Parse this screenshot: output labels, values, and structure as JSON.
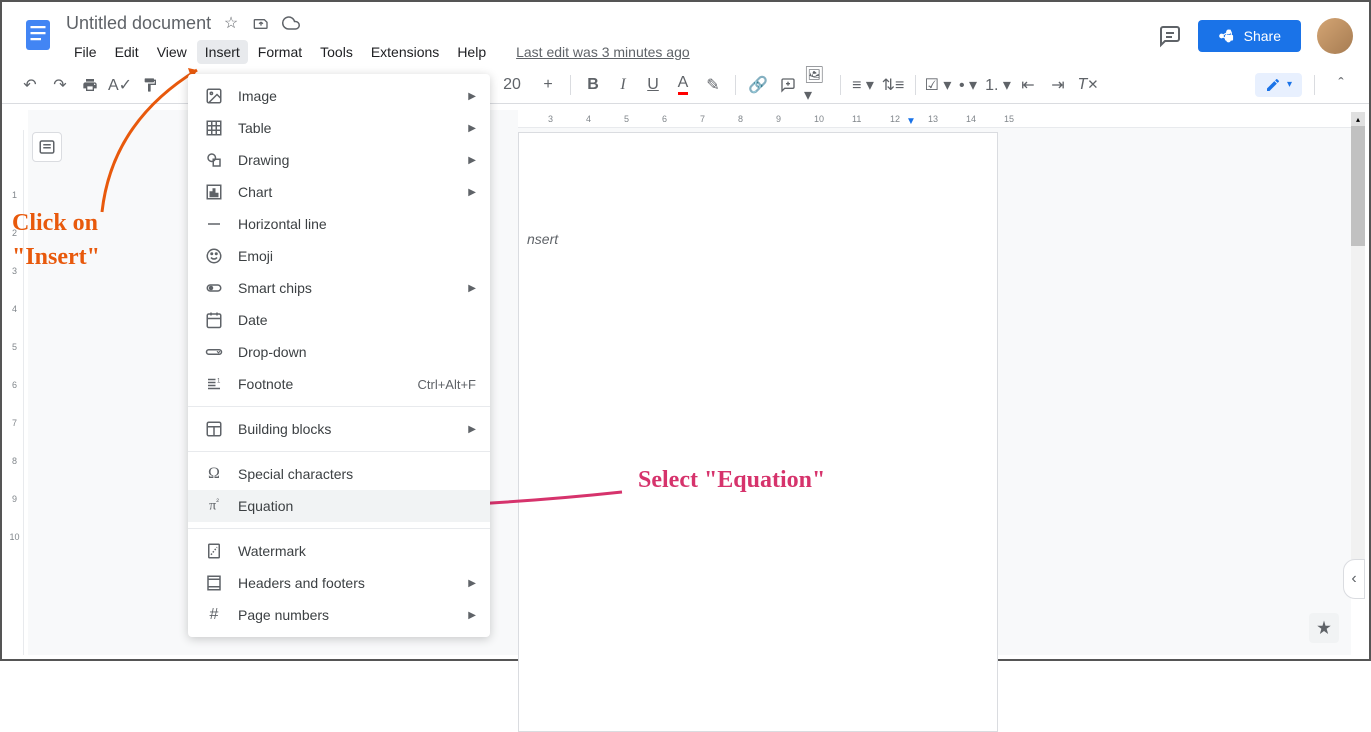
{
  "doc_title": "Untitled document",
  "menubar": [
    "File",
    "Edit",
    "View",
    "Insert",
    "Format",
    "Tools",
    "Extensions",
    "Help"
  ],
  "active_menu_index": 3,
  "last_edit": "Last edit was 3 minutes ago",
  "share_label": "Share",
  "toolbar_font_size": "20",
  "toolbar_plus": "+",
  "dropdown": [
    {
      "icon": "image",
      "label": "Image",
      "arrow": true
    },
    {
      "icon": "table",
      "label": "Table",
      "arrow": true
    },
    {
      "icon": "drawing",
      "label": "Drawing",
      "arrow": true
    },
    {
      "icon": "chart",
      "label": "Chart",
      "arrow": true
    },
    {
      "icon": "hrule",
      "label": "Horizontal line"
    },
    {
      "icon": "emoji",
      "label": "Emoji"
    },
    {
      "icon": "smartchip",
      "label": "Smart chips",
      "arrow": true
    },
    {
      "icon": "date",
      "label": "Date"
    },
    {
      "icon": "dropdown",
      "label": "Drop-down"
    },
    {
      "icon": "footnote",
      "label": "Footnote",
      "shortcut": "Ctrl+Alt+F"
    },
    {
      "sep": true
    },
    {
      "icon": "blocks",
      "label": "Building blocks",
      "arrow": true
    },
    {
      "sep": true
    },
    {
      "icon": "omega",
      "label": "Special characters"
    },
    {
      "icon": "pi",
      "label": "Equation",
      "highlighted": true
    },
    {
      "sep": true
    },
    {
      "icon": "watermark",
      "label": "Watermark"
    },
    {
      "icon": "headers",
      "label": "Headers and footers",
      "arrow": true
    },
    {
      "icon": "pagenum",
      "label": "Page numbers",
      "arrow": true
    }
  ],
  "page_hint": "nsert",
  "ruler_h_ticks": [
    "3",
    "4",
    "5",
    "6",
    "7",
    "8",
    "9",
    "10",
    "11",
    "12",
    "13",
    "14",
    "15"
  ],
  "ruler_v_ticks": [
    "1",
    "2",
    "3",
    "4",
    "5",
    "6",
    "7",
    "8",
    "9",
    "10"
  ],
  "annotations": {
    "insert_text": "Click on\n\"Insert\"",
    "equation_text": "Select \"Equation\""
  }
}
